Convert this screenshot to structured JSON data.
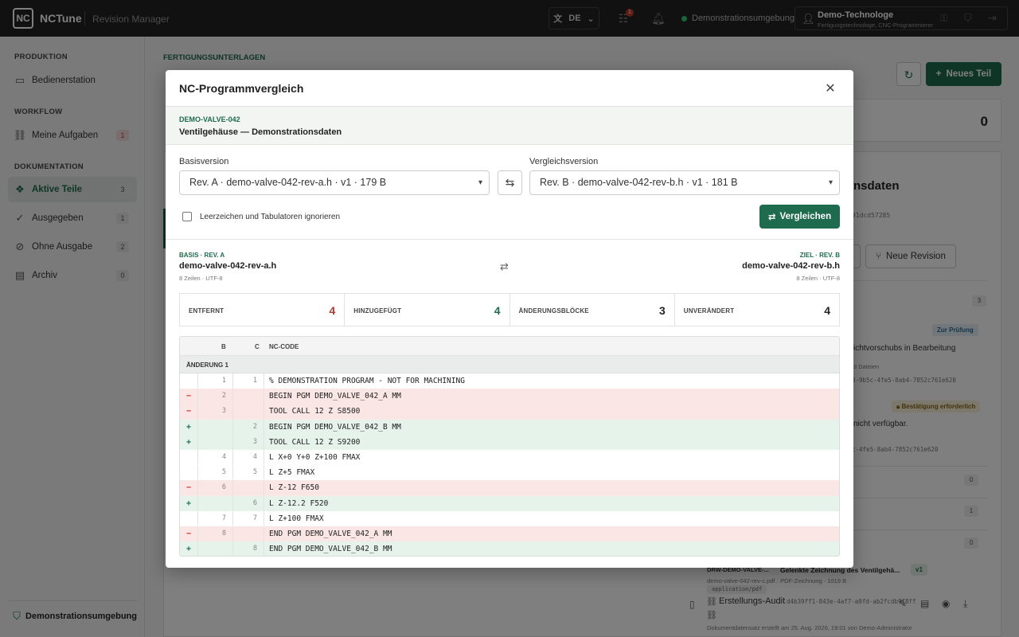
{
  "topbar": {
    "logo": "NC",
    "brand": "NCTune",
    "subbrand": "Revision Manager",
    "language": "DE",
    "notification_count": "1",
    "environment": "Demonstrationsumgebung",
    "user_name": "Demo-Technologe",
    "user_role": "Fertigungstechnologe, CNC-Programmierer"
  },
  "sidebar": {
    "sections": [
      {
        "title": "PRODUKTION",
        "items": [
          {
            "label": "Bedienerstation",
            "icon": "monitor-icon",
            "count": ""
          }
        ]
      },
      {
        "title": "WORKFLOW",
        "items": [
          {
            "label": "Meine Aufgaben",
            "icon": "tasks-icon",
            "count": "1"
          }
        ]
      },
      {
        "title": "DOKUMENTATION",
        "items": [
          {
            "label": "Aktive Teile",
            "icon": "parts-icon",
            "count": "3"
          },
          {
            "label": "Ausgegeben",
            "icon": "check-circle-icon",
            "count": "1"
          },
          {
            "label": "Ohne Ausgabe",
            "icon": "no-release-icon",
            "count": "2"
          },
          {
            "label": "Archiv",
            "icon": "archive-icon",
            "count": "0"
          }
        ]
      }
    ],
    "footer": "Demonstrationsumgebung"
  },
  "background": {
    "crumb": "FERTIGUNGSUNTERLAGEN",
    "new_part": "Neues Teil",
    "stat_value": "0",
    "right_title_fragment": "nsdaten",
    "hash_fragment": "01dcd57285",
    "new_revision": "Neue Revision",
    "count_a": "3",
    "tag_review": "Zur Prüfung",
    "text_a": "ichtvorschubs in Bearbeitung",
    "small_a": "3 Dateien",
    "hash_b": "8-9b5c-4fe5-8ab4-7852c761e620",
    "tag_confirm": "Bestätigung erforderlich",
    "text_b": "nicht verfügbar.",
    "hash_c": "c-4fe5-8ab4-7852c761e620",
    "count_b": "0",
    "count_c": "1",
    "count_d": "0",
    "drawing_id": "DRW-DEMO-VALVE-...",
    "drawing_title": "Gelenkte Zeichnung des Ventilgehä...",
    "drawing_ver": "v1",
    "drawing_file": "demo-valve-042-rev-c.pdf · PDF-Zeichnung · 1019 B",
    "drawing_mime": "application/pdf",
    "audit": "Erstellungs-Audit",
    "audit_hash": "d4b39ff1-843e-4af7-a9fd-ab2fcdb9f8ff",
    "audit_note": "Dokumentdatensatz erstellt am 25. Aug. 2026, 19:01 von Demo-Administrator"
  },
  "modal": {
    "title": "NC-Programmvergleich",
    "part_id": "DEMO-VALVE-042",
    "part_name": "Ventilgehäuse — Demonstrationsdaten",
    "base_label": "Basisversion",
    "base_value": "Rev. A · demo-valve-042-rev-a.h · v1 · 179 B",
    "compare_label": "Vergleichsversion",
    "compare_value": "Rev. B · demo-valve-042-rev-b.h · v1 · 181 B",
    "ignore_ws": "Leerzeichen und Tabulatoren ignorieren",
    "compare_button": "Vergleichen",
    "base_tag": "BASIS · REV. A",
    "base_file": "demo-valve-042-rev-a.h",
    "base_meta": "8 Zeilen · UTF-8",
    "target_tag": "ZIEL · REV. B",
    "target_file": "demo-valve-042-rev-b.h",
    "target_meta": "8 Zeilen · UTF-8",
    "stats": [
      {
        "label": "ENTFERNT",
        "value": "4",
        "tone": "red"
      },
      {
        "label": "HINZUGEFÜGT",
        "value": "4",
        "tone": "green"
      },
      {
        "label": "ÄNDERUNGSBLÖCKE",
        "value": "3",
        "tone": ""
      },
      {
        "label": "UNVERÄNDERT",
        "value": "4",
        "tone": ""
      }
    ],
    "diff": {
      "col_b": "B",
      "col_c": "C",
      "col_code": "NC-CODE",
      "hunk": "ÄNDERUNG 1",
      "rows": [
        {
          "type": "ctx",
          "sign": "",
          "b": "1",
          "c": "1",
          "code": "% DEMONSTRATION PROGRAM - NOT FOR MACHINING"
        },
        {
          "type": "del",
          "sign": "−",
          "b": "2",
          "c": "",
          "code": "BEGIN PGM DEMO_VALVE_042_A MM"
        },
        {
          "type": "del",
          "sign": "−",
          "b": "3",
          "c": "",
          "code": "TOOL CALL 12 Z S8500"
        },
        {
          "type": "add",
          "sign": "+",
          "b": "",
          "c": "2",
          "code": "BEGIN PGM DEMO_VALVE_042_B MM"
        },
        {
          "type": "add",
          "sign": "+",
          "b": "",
          "c": "3",
          "code": "TOOL CALL 12 Z S9200"
        },
        {
          "type": "ctx",
          "sign": "",
          "b": "4",
          "c": "4",
          "code": "L X+0 Y+0 Z+100 FMAX"
        },
        {
          "type": "ctx",
          "sign": "",
          "b": "5",
          "c": "5",
          "code": "L Z+5 FMAX"
        },
        {
          "type": "del",
          "sign": "−",
          "b": "6",
          "c": "",
          "code": "L Z-12 F650"
        },
        {
          "type": "add",
          "sign": "+",
          "b": "",
          "c": "6",
          "code": "L Z-12.2 F520"
        },
        {
          "type": "ctx",
          "sign": "",
          "b": "7",
          "c": "7",
          "code": "L Z+100 FMAX"
        },
        {
          "type": "del",
          "sign": "−",
          "b": "8",
          "c": "",
          "code": "END PGM DEMO_VALVE_042_A MM"
        },
        {
          "type": "add",
          "sign": "+",
          "b": "",
          "c": "8",
          "code": "END PGM DEMO_VALVE_042_B MM"
        }
      ]
    }
  }
}
